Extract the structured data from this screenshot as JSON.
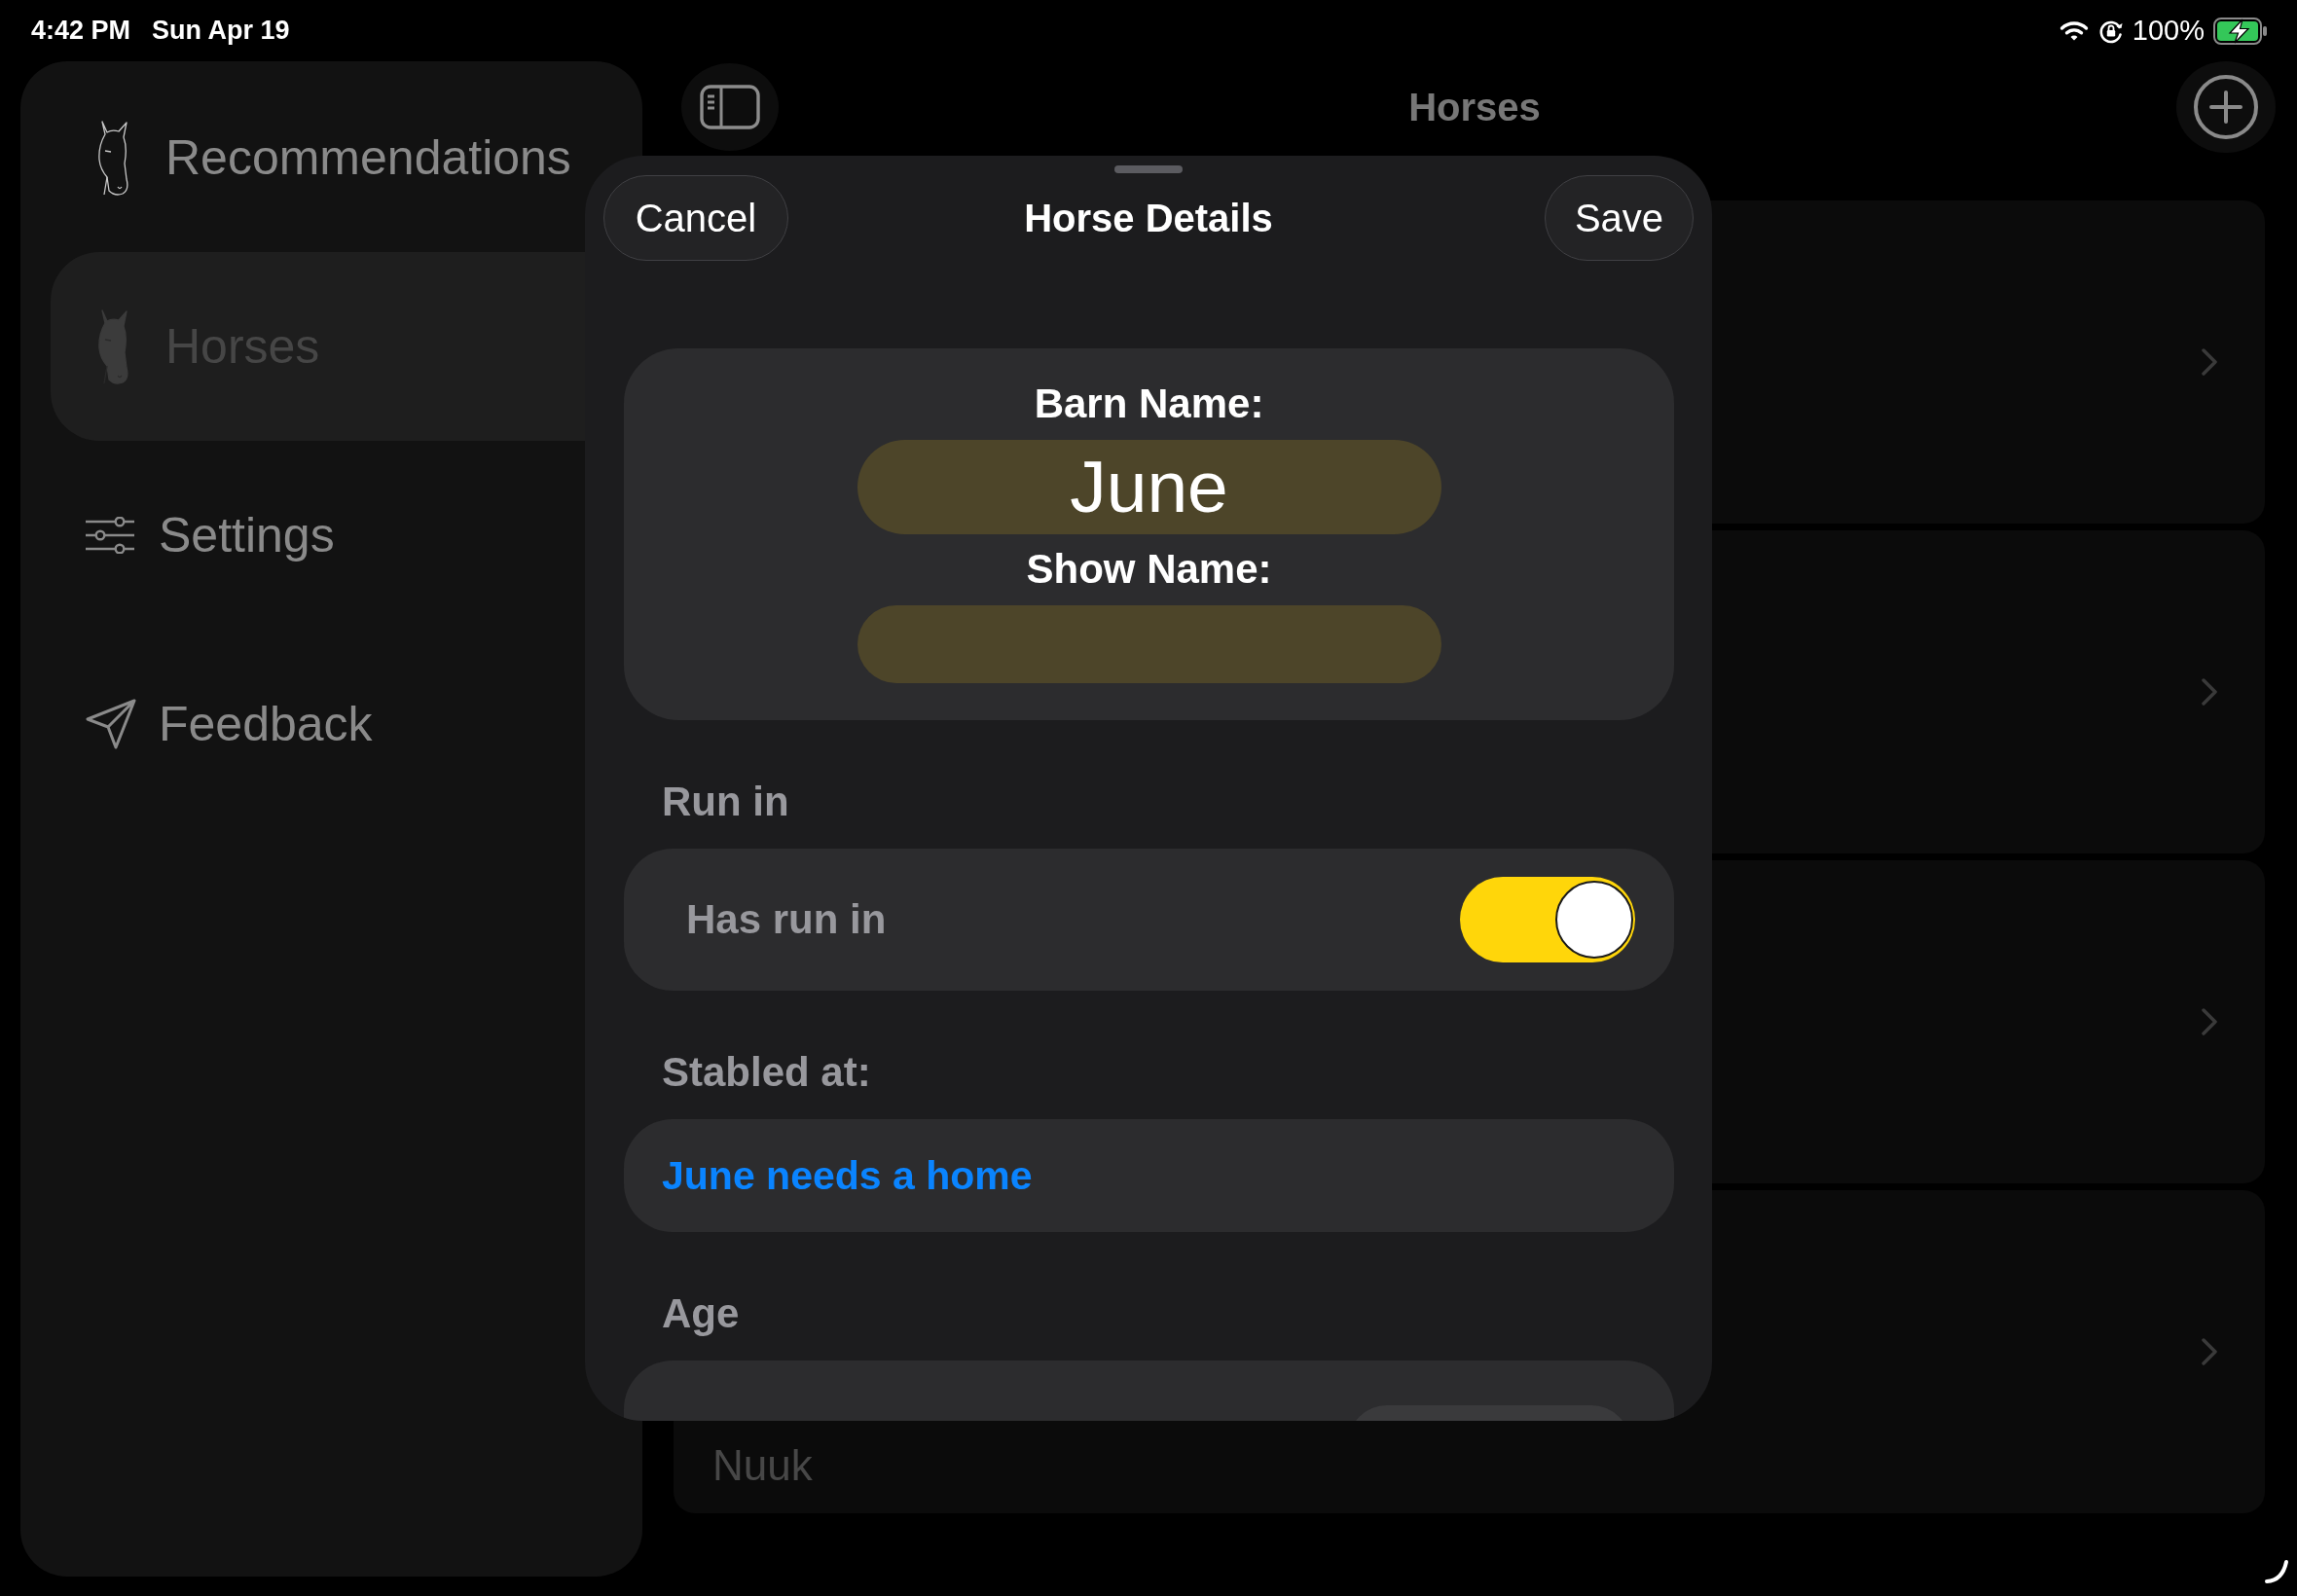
{
  "status_bar": {
    "time": "4:42 PM",
    "date": "Sun Apr 19",
    "battery": "100%"
  },
  "sidebar": {
    "items": [
      {
        "label": "Recommendations",
        "selected": false
      },
      {
        "label": "Horses",
        "selected": true
      },
      {
        "label": "Settings",
        "selected": false
      },
      {
        "label": "Feedback",
        "selected": false
      }
    ]
  },
  "navigation_bar": {
    "title": "Horses"
  },
  "list": {
    "rows": [
      {
        "disclosure": true
      },
      {
        "disclosure": true
      },
      {
        "disclosure": true
      },
      {
        "disclosure": true,
        "title": "Nuuk"
      }
    ]
  },
  "sheet": {
    "cancel": "Cancel",
    "title": "Horse Details",
    "save": "Save",
    "barn_name": {
      "label": "Barn Name:",
      "value": "June"
    },
    "show_name": {
      "label": "Show Name:"
    },
    "sections": [
      {
        "kind": "toggle",
        "header": "Run in",
        "label": "Has run in",
        "on": true
      },
      {
        "kind": "link",
        "header": "Stabled at:",
        "text": "June needs a home"
      },
      {
        "kind": "picker",
        "header": "Age"
      }
    ]
  }
}
